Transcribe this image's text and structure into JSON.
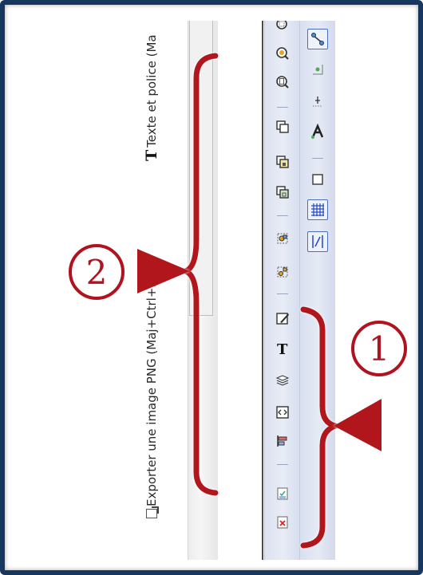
{
  "status_bar": {
    "export_label": "Exporter une image PNG (Maj+Ctrl+E)",
    "text_label": "Texte et police (Ma"
  },
  "toolbar_left": {
    "icons": [
      "zoom-drawing-icon",
      "zoom-selection-icon",
      "zoom-page-icon",
      "duplicate-icon",
      "clone-icon",
      "unlink-clone-icon",
      "group-icon",
      "ungroup-icon",
      "fill-stroke-icon",
      "text-font-icon",
      "layers-icon",
      "xml-editor-icon",
      "align-distribute-icon",
      "preferences-icon",
      "close-document-icon"
    ]
  },
  "toolbar_right": {
    "icons": [
      "snap-toggle-icon",
      "snap-nodes-icon",
      "snap-guides-icon",
      "snap-text-icon",
      "snap-page-icon",
      "snap-grid-icon",
      "snap-guide-lines-icon"
    ]
  },
  "annotations": {
    "callout_1": "1",
    "callout_2": "2",
    "color": "#b0121f"
  },
  "colors": {
    "frame": "#17375e",
    "toolbar": "#dce2f0",
    "accent": "#4d6fbf"
  }
}
